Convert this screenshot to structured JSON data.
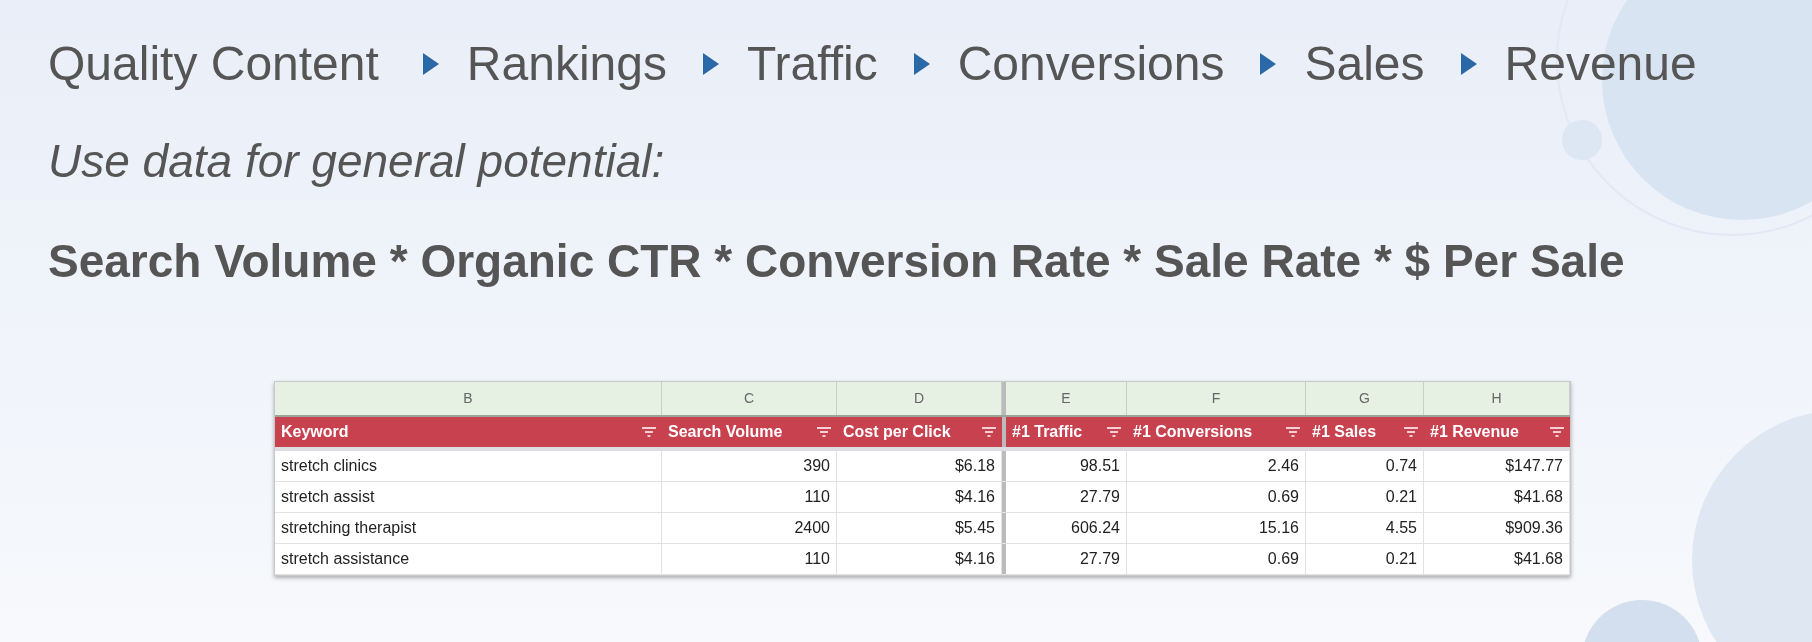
{
  "flow": [
    "Quality Content",
    "Rankings",
    "Traffic",
    "Conversions",
    "Sales",
    "Revenue"
  ],
  "subtitle": "Use data for general potential:",
  "formula": "Search Volume * Organic CTR * Conversion Rate * Sale Rate * $ Per Sale",
  "sheet": {
    "column_letters": [
      "B",
      "C",
      "D",
      "E",
      "F",
      "G",
      "H"
    ],
    "headers": [
      "Keyword",
      "Search Volume",
      "Cost per Click",
      "#1 Traffic",
      "#1 Conversions",
      "#1 Sales",
      "#1 Revenue"
    ],
    "rows": [
      [
        "stretch clinics",
        "390",
        "$6.18",
        "98.51",
        "2.46",
        "0.74",
        "$147.77"
      ],
      [
        "stretch assist",
        "110",
        "$4.16",
        "27.79",
        "0.69",
        "0.21",
        "$41.68"
      ],
      [
        "stretching therapist",
        "2400",
        "$5.45",
        "606.24",
        "15.16",
        "4.55",
        "$909.36"
      ],
      [
        "stretch assistance",
        "110",
        "$4.16",
        "27.79",
        "0.69",
        "0.21",
        "$41.68"
      ]
    ]
  }
}
